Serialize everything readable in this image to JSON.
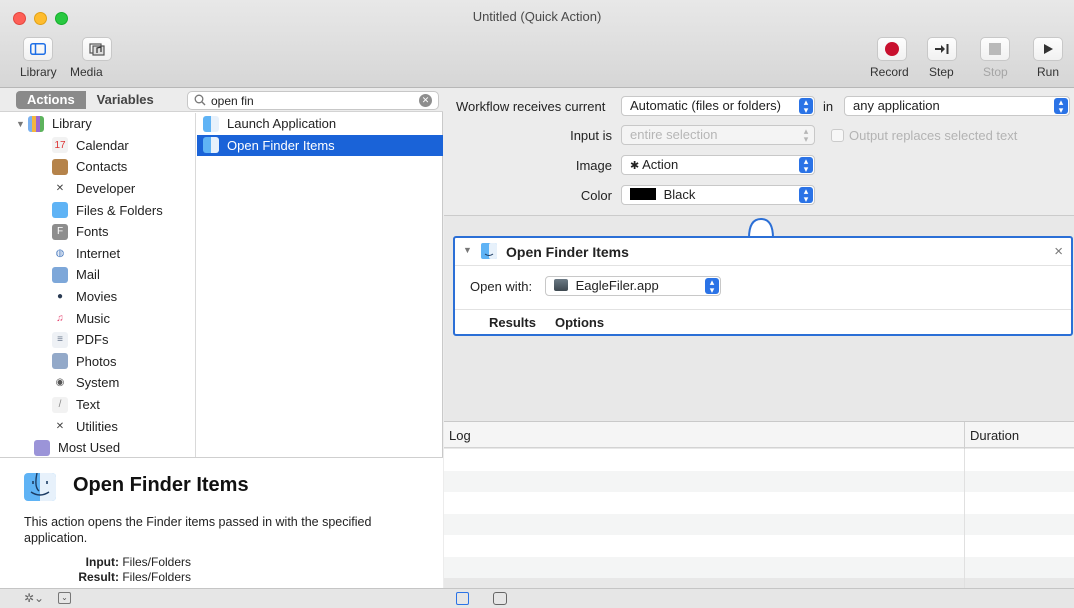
{
  "window": {
    "title": "Untitled (Quick Action)"
  },
  "toolbar": {
    "library_label": "Library",
    "media_label": "Media",
    "record_label": "Record",
    "step_label": "Step",
    "stop_label": "Stop",
    "run_label": "Run"
  },
  "library": {
    "tab_actions": "Actions",
    "tab_variables": "Variables",
    "search_value": "open fin",
    "root": "Library",
    "categories": [
      {
        "label": "Calendar",
        "icon": "calendar-icon"
      },
      {
        "label": "Contacts",
        "icon": "contacts-icon"
      },
      {
        "label": "Developer",
        "icon": "developer-icon"
      },
      {
        "label": "Files & Folders",
        "icon": "finder-icon"
      },
      {
        "label": "Fonts",
        "icon": "fonts-icon"
      },
      {
        "label": "Internet",
        "icon": "internet-icon"
      },
      {
        "label": "Mail",
        "icon": "mail-icon"
      },
      {
        "label": "Movies",
        "icon": "movies-icon"
      },
      {
        "label": "Music",
        "icon": "music-icon"
      },
      {
        "label": "PDFs",
        "icon": "pdf-icon"
      },
      {
        "label": "Photos",
        "icon": "photos-icon"
      },
      {
        "label": "System",
        "icon": "system-icon"
      },
      {
        "label": "Text",
        "icon": "text-icon"
      },
      {
        "label": "Utilities",
        "icon": "utilities-icon"
      }
    ],
    "most_used": "Most Used",
    "actions": [
      {
        "label": "Launch Application",
        "selected": false
      },
      {
        "label": "Open Finder Items",
        "selected": true
      }
    ]
  },
  "description": {
    "title": "Open Finder Items",
    "text": "This action opens the Finder items passed in with the specified application.",
    "input_key": "Input:",
    "input_value": "Files/Folders",
    "result_key": "Result:",
    "result_value": "Files/Folders"
  },
  "workflow": {
    "receives_label": "Workflow receives current",
    "receives_value": "Automatic (files or folders)",
    "in_label": "in",
    "app_value": "any application",
    "input_is_label": "Input is",
    "input_is_value": "entire selection",
    "output_replaces_label": "Output replaces selected text",
    "image_label": "Image",
    "image_value": "Action",
    "color_label": "Color",
    "color_value": "Black",
    "color_swatch": "#000000"
  },
  "action_card": {
    "title": "Open Finder Items",
    "open_with_label": "Open with:",
    "open_with_value": "EagleFiler.app",
    "tab_results": "Results",
    "tab_options": "Options",
    "close": "×"
  },
  "log": {
    "col_log": "Log",
    "col_duration": "Duration"
  },
  "colors": {
    "accent": "#1a63d8",
    "record": "#c8102e"
  }
}
